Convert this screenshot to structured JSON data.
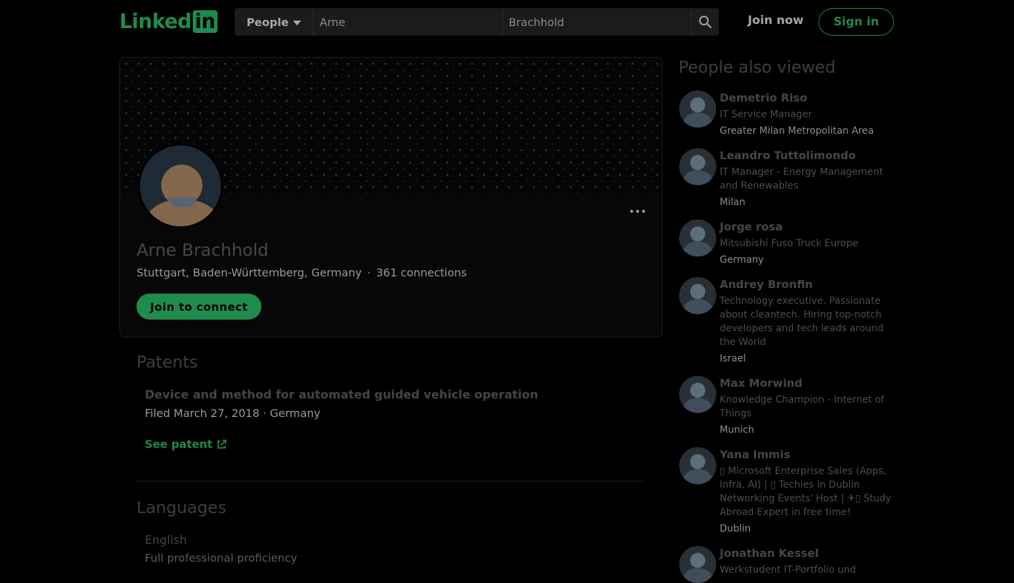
{
  "header": {
    "logo_text": "Linked",
    "logo_badge": "in",
    "search_category": "People",
    "first_name_value": "Arne",
    "last_name_value": "Brachhold",
    "search_icon": "search-icon",
    "join_now": "Join now",
    "sign_in": "Sign in"
  },
  "profile": {
    "name": "Arne Brachhold",
    "location": "Stuttgart, Baden-Württemberg, Germany",
    "separator": "·",
    "connections": "361 connections",
    "more_label": "···",
    "connect_button": "Join to connect"
  },
  "patents": {
    "title": "Patents",
    "items": [
      {
        "title": "Device and method for automated guided vehicle operation",
        "meta": "Filed March 27, 2018 · Germany",
        "link_label": "See patent"
      }
    ]
  },
  "languages": {
    "title": "Languages",
    "items": [
      {
        "name": "English",
        "level": "Full professional proficiency"
      }
    ]
  },
  "sidebar": {
    "title": "People also viewed",
    "people": [
      {
        "name": "Demetrio Riso",
        "headline": "IT Service Manager",
        "location": "Greater Milan Metropolitan Area"
      },
      {
        "name": "Leandro Tuttolimondo",
        "headline": "IT Manager - Energy Management and Renewables",
        "location": "Milan"
      },
      {
        "name": "Jorge rosa",
        "headline": "Mitsubishi Fuso Truck Europe",
        "location": "Germany"
      },
      {
        "name": "Andrey Bronfin",
        "headline": "Technology executive. Passionate about cleantech. Hiring top-notch developers and tech leads around the World",
        "location": "Israel"
      },
      {
        "name": "Max Morwind",
        "headline": "Knowledge Champion - Internet of Things",
        "location": "Munich"
      },
      {
        "name": "Yana Immis",
        "headline": "▯ Microsoft Enterprise Sales (Apps, Infra, AI) | ▯ Techies in Dublin Networking Events' Host | ✈▯ Study Abroad Expert in free time!",
        "location": "Dublin"
      },
      {
        "name": "Jonathan Kessel",
        "headline": "Werkstudent IT-Portfolio und",
        "location": ""
      }
    ]
  }
}
